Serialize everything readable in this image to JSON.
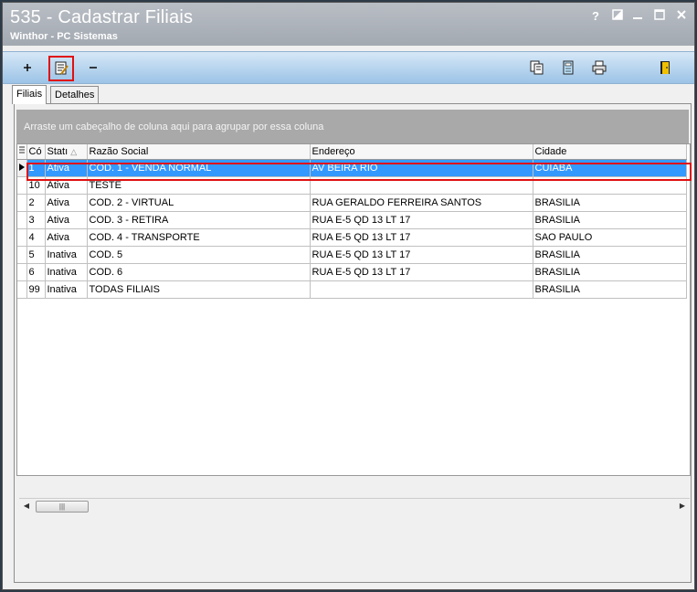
{
  "window": {
    "title": "535 - Cadastrar Filiais",
    "subtitle": "Winthor - PC Sistemas",
    "controls": [
      "?",
      "◩",
      "—",
      "☐",
      "✕"
    ]
  },
  "toolbar": {
    "left_icons": [
      "plus-icon",
      "edit-record-icon",
      "minus-icon"
    ],
    "right_icons": [
      "copy-icon",
      "calculator-icon",
      "print-icon",
      "exit-door-icon"
    ]
  },
  "tabs": [
    {
      "label": "Filiais",
      "active": true
    },
    {
      "label": "Detalhes",
      "active": false
    }
  ],
  "grid": {
    "groupby_hint": "Arraste um cabeçalho de coluna aqui para agrupar por essa coluna",
    "columns": [
      "Cód",
      "Status",
      "Razão Social",
      "Endereço",
      "Cidade"
    ],
    "column_display": [
      "Có",
      "Statı",
      "Razão Social",
      "Endereço",
      "Cidade"
    ],
    "sort_indicator": "△",
    "rows": [
      {
        "cod": "1",
        "status": "Ativa",
        "razao": "COD. 1 - VENDA NORMAL",
        "endereco": "AV BEIRA RIO",
        "cidade": "CUIABA",
        "selected": true
      },
      {
        "cod": "10",
        "status": "Ativa",
        "razao": "TESTE",
        "endereco": "",
        "cidade": ""
      },
      {
        "cod": "2",
        "status": "Ativa",
        "razao": "COD. 2 - VIRTUAL",
        "endereco": "RUA GERALDO FERREIRA SANTOS",
        "cidade": "BRASILIA"
      },
      {
        "cod": "3",
        "status": "Ativa",
        "razao": "COD. 3 - RETIRA",
        "endereco": "RUA E-5 QD 13 LT 17",
        "cidade": "BRASILIA"
      },
      {
        "cod": "4",
        "status": "Ativa",
        "razao": "COD. 4 - TRANSPORTE",
        "endereco": "RUA E-5 QD 13 LT 17",
        "cidade": "SAO PAULO"
      },
      {
        "cod": "5",
        "status": "Inativa",
        "razao": "COD. 5",
        "endereco": "RUA E-5 QD 13 LT 17",
        "cidade": "BRASILIA"
      },
      {
        "cod": "6",
        "status": "Inativa",
        "razao": "COD. 6",
        "endereco": "RUA E-5 QD 13 LT 17",
        "cidade": "BRASILIA"
      },
      {
        "cod": "99",
        "status": "Inativa",
        "razao": "TODAS FILIAIS",
        "endereco": "",
        "cidade": "BRASILIA"
      }
    ]
  },
  "colors": {
    "selection": "#3399ff",
    "highlight_outline": "#e01010"
  }
}
